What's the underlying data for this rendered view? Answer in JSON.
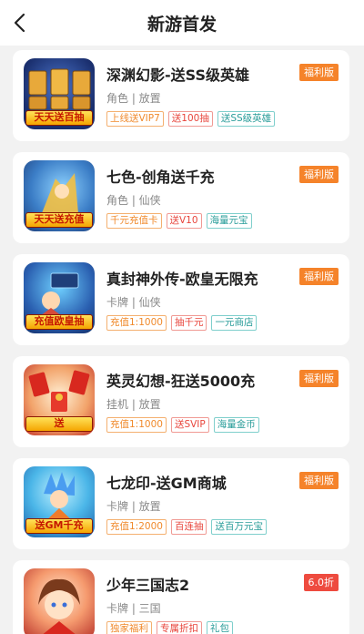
{
  "header": {
    "title": "新游首发",
    "back_icon": "chevron-left-icon"
  },
  "games": [
    {
      "name": "深渊幻影-送SS级英雄",
      "category": "角色 | 放置",
      "badge": "福利版",
      "badge_color": "#f5832a",
      "icon_text": "天天送百抽",
      "tags": [
        "上线送VIP7",
        "送100抽",
        "送SS级英雄"
      ]
    },
    {
      "name": "七色-创角送千充",
      "category": "角色 | 仙侠",
      "badge": "福利版",
      "badge_color": "#f5832a",
      "icon_text": "天天送充值",
      "tags": [
        "千元充值卡",
        "送V10",
        "海量元宝"
      ]
    },
    {
      "name": "真封神外传-欧皇无限充",
      "category": "卡牌 | 仙侠",
      "badge": "福利版",
      "badge_color": "#f5832a",
      "icon_text": "充值欧皇抽",
      "tags": [
        "充值1:1000",
        "抽千元",
        "一元商店"
      ]
    },
    {
      "name": "英灵幻想-狂送5000充",
      "category": "挂机 | 放置",
      "badge": "福利版",
      "badge_color": "#f5832a",
      "icon_text": "送",
      "tags": [
        "充值1:1000",
        "送SVIP",
        "海量金币"
      ]
    },
    {
      "name": "七龙印-送GM商城",
      "category": "卡牌 | 放置",
      "badge": "福利版",
      "badge_color": "#f5832a",
      "icon_text": "送GM千充",
      "tags": [
        "充值1:2000",
        "百连抽",
        "送百万元宝"
      ]
    },
    {
      "name": "少年三国志2",
      "category": "卡牌 | 三国",
      "badge": "6.0折",
      "badge_color": "#ee4b3f",
      "icon_text": "",
      "tags": [
        "独家福利",
        "专属折扣",
        "礼包"
      ]
    }
  ]
}
